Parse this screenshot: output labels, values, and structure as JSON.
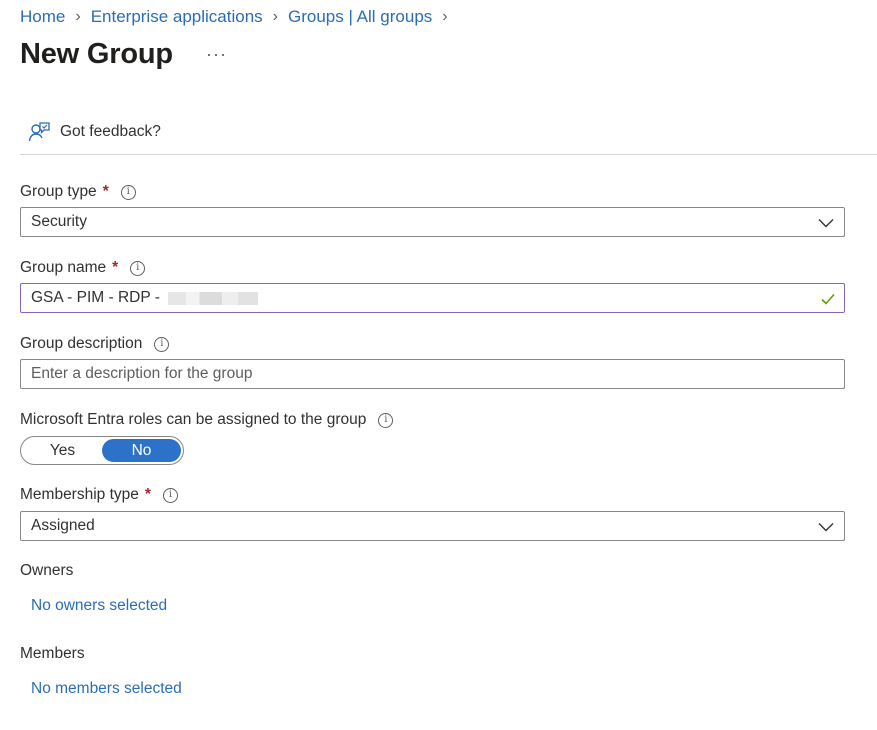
{
  "breadcrumb": [
    "Home",
    "Enterprise applications",
    "Groups | All groups"
  ],
  "page": {
    "title": "New Group",
    "more": "···"
  },
  "feedback": {
    "label": "Got feedback?"
  },
  "form": {
    "group_type": {
      "label": "Group type",
      "required": "*",
      "value": "Security"
    },
    "group_name": {
      "label": "Group name",
      "required": "*",
      "value": "GSA - PIM - RDP -"
    },
    "group_description": {
      "label": "Group description",
      "placeholder": "Enter a description for the group"
    },
    "entra_roles": {
      "label": "Microsoft Entra roles can be assigned to the group",
      "options": [
        "Yes",
        "No"
      ],
      "selected": "No"
    },
    "membership_type": {
      "label": "Membership type",
      "required": "*",
      "value": "Assigned"
    },
    "owners": {
      "label": "Owners",
      "link": "No owners selected"
    },
    "members": {
      "label": "Members",
      "link": "No members selected"
    }
  },
  "colors": {
    "link": "#2b6cb8",
    "required": "#a4262c",
    "toggle_selected": "#2c72c9",
    "valid_check": "#57a300"
  }
}
